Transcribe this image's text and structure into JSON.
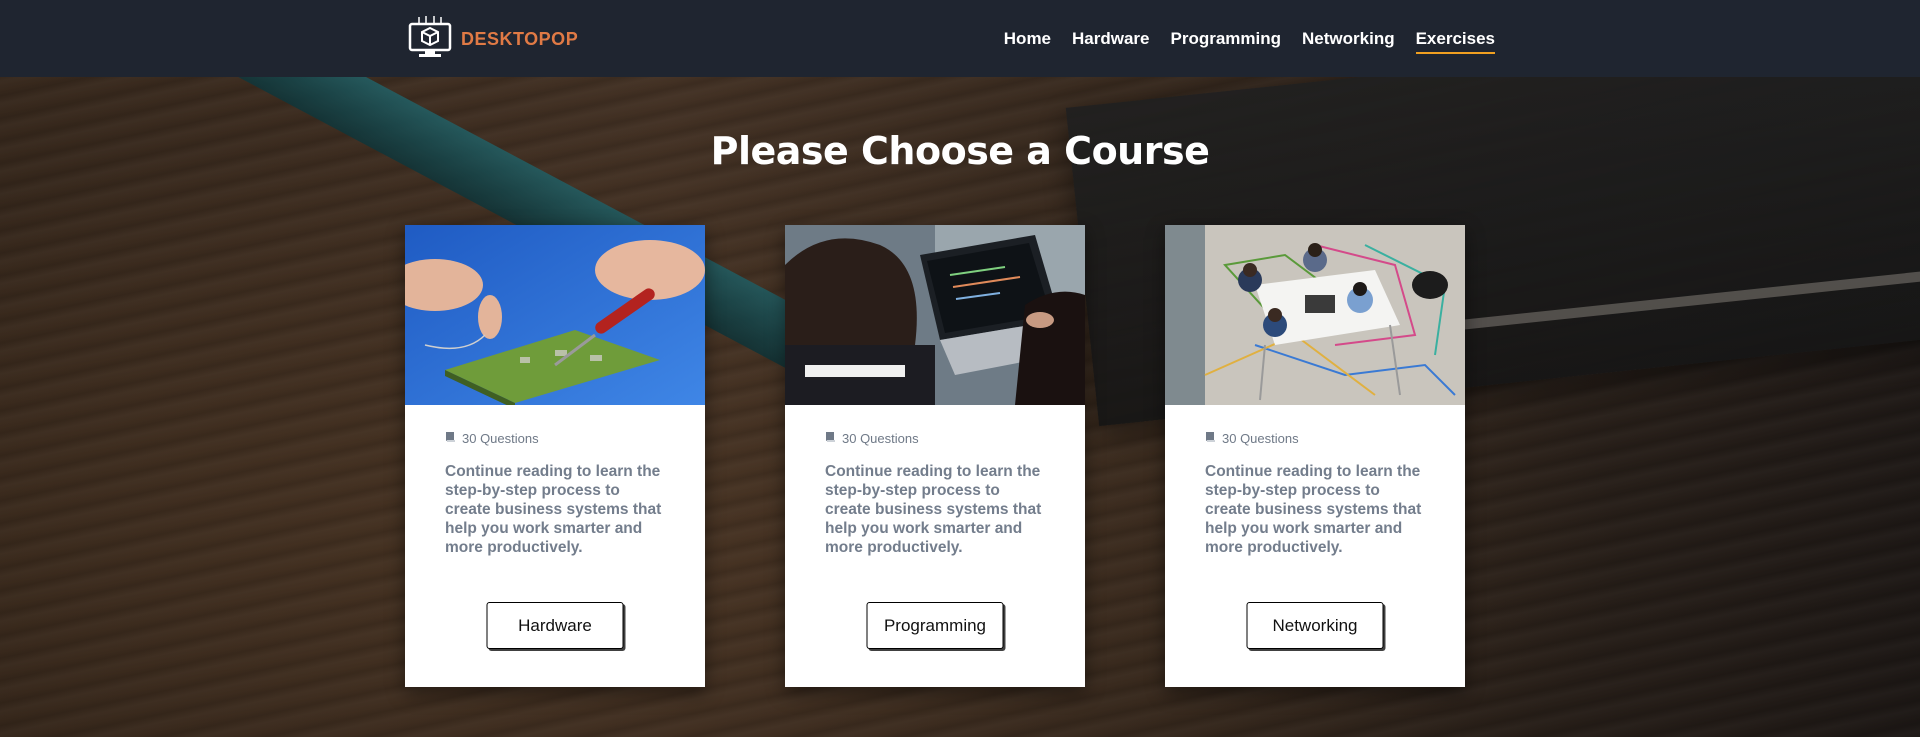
{
  "brand": {
    "name": "DESKTOPOP",
    "logo_icon": "computer-monitor-cube-icon",
    "accent_color": "#e07a45"
  },
  "nav": {
    "items": [
      {
        "label": "Home",
        "active": false
      },
      {
        "label": "Hardware",
        "active": false
      },
      {
        "label": "Programming",
        "active": false
      },
      {
        "label": "Networking",
        "active": false
      },
      {
        "label": "Exercises",
        "active": true
      }
    ],
    "active_underline_color": "#f0a021"
  },
  "page": {
    "title": "Please Choose a Course"
  },
  "cards": [
    {
      "image": "soldering-circuit-board-photo",
      "meta_icon": "book-icon",
      "meta": "30 Questions",
      "description": "Continue reading to learn the step-by-step process to create business systems that help you work smarter and more productively.",
      "button": "Hardware"
    },
    {
      "image": "people-coding-on-laptop-photo",
      "meta_icon": "book-icon",
      "meta": "30 Questions",
      "description": "Continue reading to learn the step-by-step process to create business systems that help you work smarter and more productively.",
      "button": "Programming"
    },
    {
      "image": "team-meeting-overhead-photo",
      "meta_icon": "book-icon",
      "meta": "30 Questions",
      "description": "Continue reading to learn the step-by-step process to create business systems that help you work smarter and more productively.",
      "button": "Networking"
    }
  ]
}
